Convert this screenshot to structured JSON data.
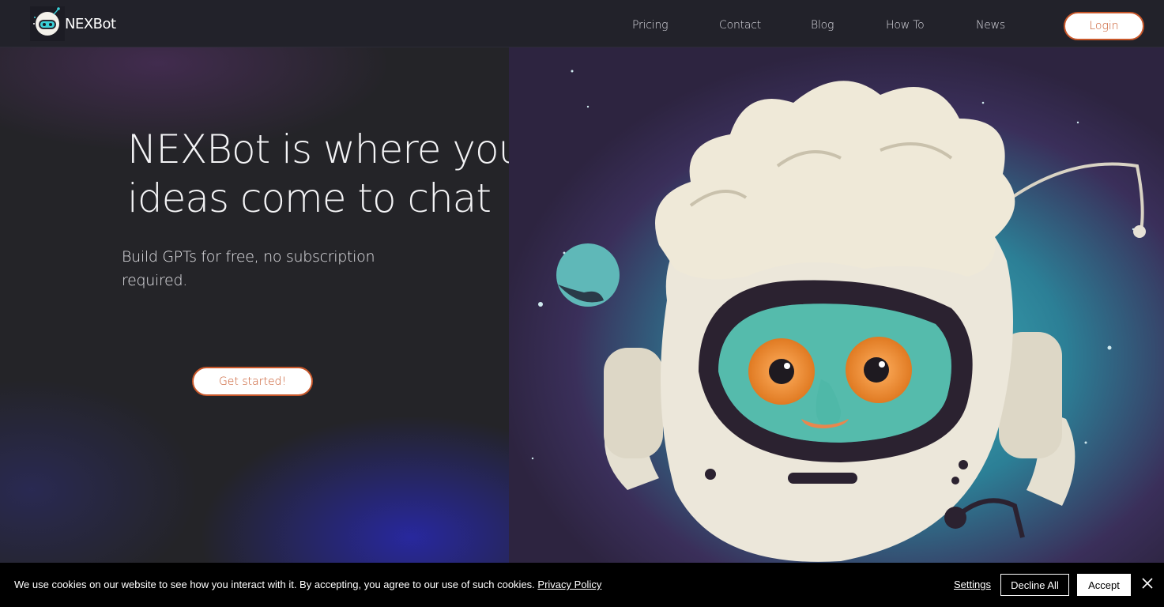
{
  "brand": {
    "name": "NEXBot",
    "logo_icon": "robot-head-icon"
  },
  "nav": {
    "items": [
      {
        "label": "Pricing"
      },
      {
        "label": "Contact"
      },
      {
        "label": "Blog"
      },
      {
        "label": "How To"
      },
      {
        "label": "News"
      }
    ],
    "login_label": "Login"
  },
  "hero": {
    "headline": "NEXBot is where your ideas come to chat",
    "subheadline": "Build GPTs for free, no subscription required.",
    "cta_label": "Get started!",
    "illustration": "astronaut-robot-illustration"
  },
  "cookie_banner": {
    "message": "We use cookies on our website to see how you interact with it. By accepting, you agree to our use of such cookies.",
    "policy_link": "Privacy Policy",
    "settings_label": "Settings",
    "decline_label": "Decline All",
    "accept_label": "Accept",
    "close_icon": "close-icon"
  },
  "colors": {
    "accent": "#c8572a",
    "header_bg": "#22222a",
    "hero_bg": "#242428",
    "cookie_bg": "#000000",
    "illustration_teal": "#3aa6b0"
  }
}
